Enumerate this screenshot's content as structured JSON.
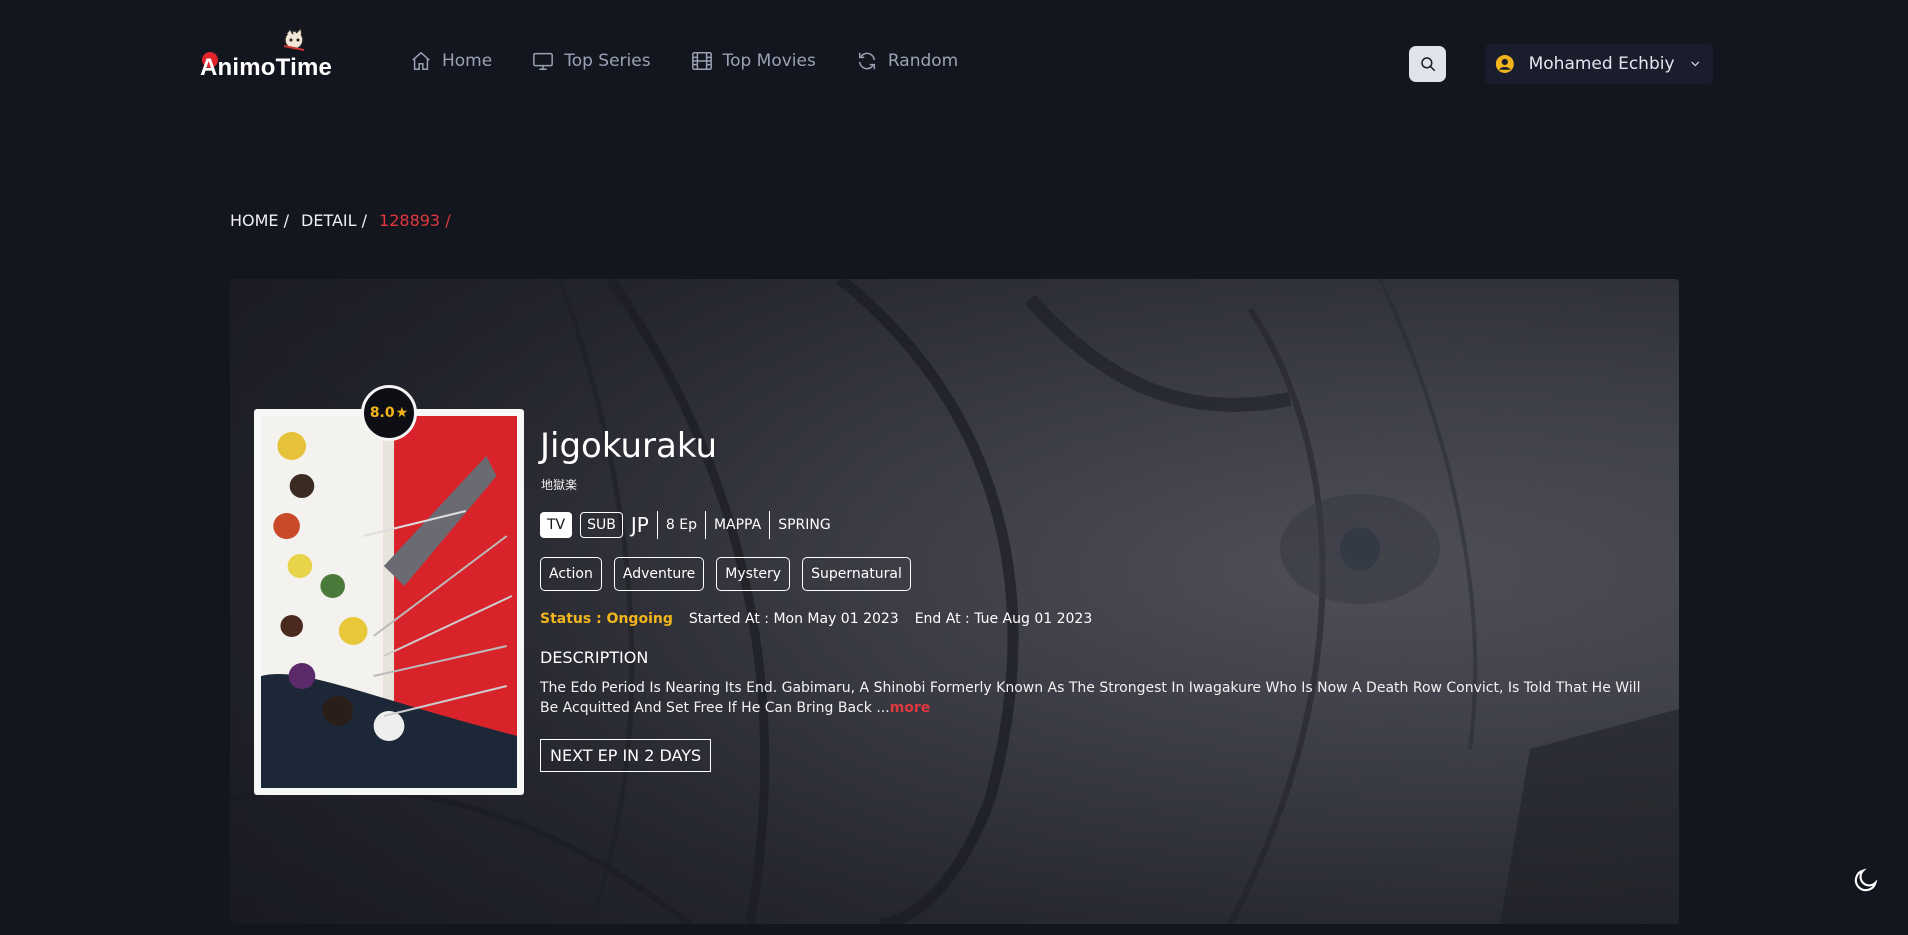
{
  "brand": {
    "name": "AnimoTime"
  },
  "nav": {
    "items": [
      {
        "label": "Home",
        "icon": "home-icon"
      },
      {
        "label": "Top Series",
        "icon": "tv-icon"
      },
      {
        "label": "Top Movies",
        "icon": "film-icon"
      },
      {
        "label": "Random",
        "icon": "refresh-icon"
      }
    ]
  },
  "user": {
    "name": "Mohamed Echbiy"
  },
  "breadcrumb": [
    "HOME /",
    "DETAIL /",
    "128893 /"
  ],
  "anime": {
    "rating": "8.0",
    "title": "Jigokuraku",
    "native_title": "地獄楽",
    "format": "TV",
    "audio": "SUB",
    "lang": "JP",
    "episodes": "8 Ep",
    "studio": "MAPPA",
    "season": "SPRING",
    "genres": [
      "Action",
      "Adventure",
      "Mystery",
      "Supernatural"
    ],
    "status": "Status : Ongoing",
    "started": "Started At : Mon May 01 2023",
    "ended": "End At : Tue Aug 01 2023",
    "description_heading": "DESCRIPTION",
    "description": "The Edo Period Is Nearing Its End. Gabimaru, A Shinobi Formerly Known As The Strongest In Iwagakure Who Is Now A Death Row Convict, Is Told That He Will Be Acquitted And Set Free If He Can Bring Back ...",
    "more_label": "more",
    "next_episode": "NEXT EP IN  2  DAYS"
  },
  "colors": {
    "accent_red": "#e2383f",
    "status_yellow": "#f2b51c",
    "background": "#13151f"
  }
}
